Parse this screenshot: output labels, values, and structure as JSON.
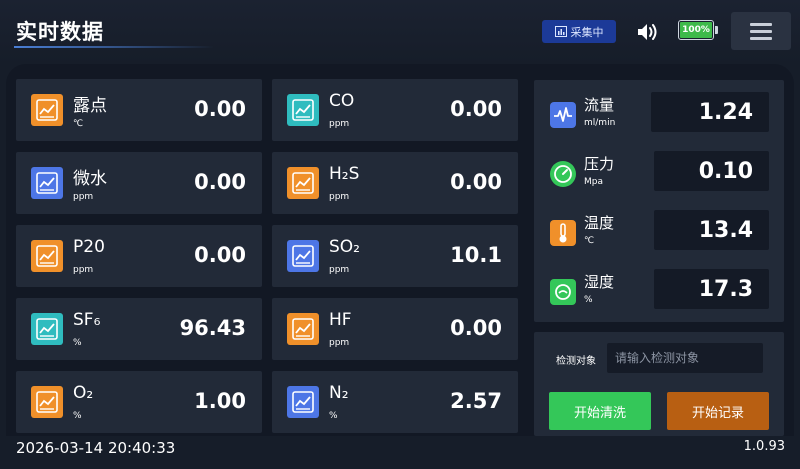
{
  "header": {
    "title": "实时数据",
    "collect_status": "采集中",
    "battery_percent": "100%",
    "battery_level": 1.0
  },
  "colors": {
    "orange_icon": "#f0902a",
    "teal_icon": "#2fbcbf",
    "blue_icon": "#4d76e6",
    "clean_button": "#34c759",
    "record_button": "#b85f12",
    "battery_fill": "#3dba4a"
  },
  "sensors": [
    {
      "name": "露点",
      "unit": "℃",
      "value": "0.00",
      "icon": "chart-icon"
    },
    {
      "name": "CO",
      "unit": "ppm",
      "value": "0.00",
      "icon": "chart-icon"
    },
    {
      "name": "微水",
      "unit": "ppm",
      "value": "0.00",
      "icon": "chart-icon"
    },
    {
      "name": "H₂S",
      "unit": "ppm",
      "value": "0.00",
      "icon": "chart-icon"
    },
    {
      "name": "P20",
      "unit": "ppm",
      "value": "0.00",
      "icon": "chart-icon"
    },
    {
      "name": "SO₂",
      "unit": "ppm",
      "value": "10.1",
      "icon": "chart-icon"
    },
    {
      "name": "SF₆",
      "unit": "%",
      "value": "96.43",
      "icon": "chart-icon"
    },
    {
      "name": "HF",
      "unit": "ppm",
      "value": "0.00",
      "icon": "chart-icon"
    },
    {
      "name": "O₂",
      "unit": "%",
      "value": "1.00",
      "icon": "chart-icon"
    },
    {
      "name": "N₂",
      "unit": "%",
      "value": "2.57",
      "icon": "chart-icon"
    }
  ],
  "readings": [
    {
      "name": "流量",
      "unit": "ml/min",
      "value": "1.24",
      "icon": "pulse-icon"
    },
    {
      "name": "压力",
      "unit": "Mpa",
      "value": "0.10",
      "icon": "gauge-icon"
    },
    {
      "name": "温度",
      "unit": "℃",
      "value": "13.4",
      "icon": "thermometer-icon"
    },
    {
      "name": "湿度",
      "unit": "%",
      "value": "17.3",
      "icon": "droplet-icon"
    }
  ],
  "detection": {
    "label": "检测对象",
    "placeholder": "请输入检测对象",
    "value": ""
  },
  "buttons": {
    "clean": "开始清洗",
    "record": "开始记录"
  },
  "footer": {
    "datetime": "2026-03-14 20:40:33",
    "version": "1.0.93"
  }
}
